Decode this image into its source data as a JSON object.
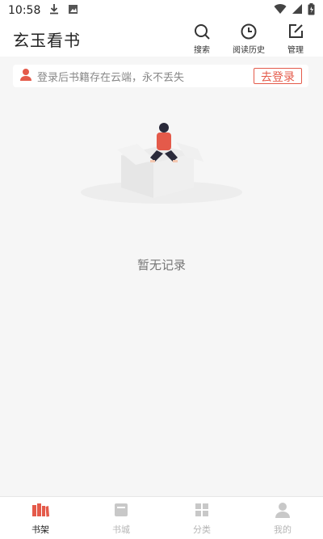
{
  "status": {
    "time": "10:58",
    "icons": [
      "download-icon",
      "image-notification-icon",
      "wifi-icon",
      "signal-icon",
      "battery-icon"
    ]
  },
  "header": {
    "title": "玄玉看书",
    "actions": [
      {
        "label": "搜索",
        "icon": "search-icon"
      },
      {
        "label": "阅读历史",
        "icon": "clock-icon"
      },
      {
        "label": "管理",
        "icon": "edit-icon"
      }
    ]
  },
  "login_banner": {
    "text": "登录后书籍存在云端，永不丢失",
    "button": "去登录",
    "icon": "user-icon"
  },
  "empty": {
    "text": "暂无记录"
  },
  "bottom_nav": {
    "items": [
      {
        "label": "书架",
        "icon": "bookshelf-icon",
        "active": true
      },
      {
        "label": "书城",
        "icon": "bookstore-icon",
        "active": false
      },
      {
        "label": "分类",
        "icon": "category-icon",
        "active": false
      },
      {
        "label": "我的",
        "icon": "profile-icon",
        "active": false
      }
    ]
  },
  "colors": {
    "accent": "#e45a4a",
    "background": "#f6f6f6",
    "inactive": "#b5b5b5"
  }
}
